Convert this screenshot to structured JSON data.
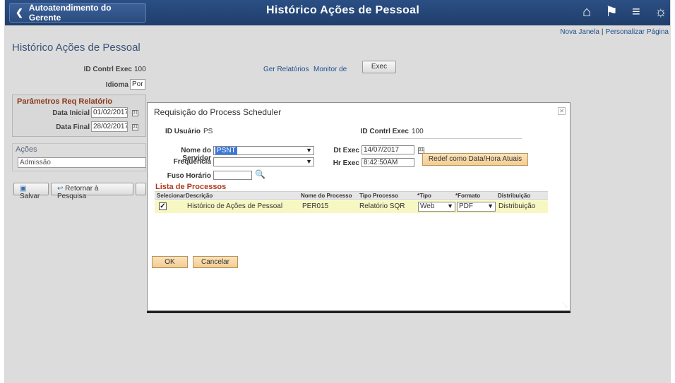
{
  "topbar": {
    "back_label": "Autoatendimento do Gerente",
    "title": "Histórico Ações de Pessoal",
    "icons": [
      "home-icon",
      "flag-icon",
      "menu-icon",
      "compass-icon"
    ]
  },
  "links": {
    "nova_janela": "Nova Janela",
    "sep": "|",
    "personalizar": "Personalizar Página"
  },
  "page": {
    "title": "Histórico Ações de Pessoal",
    "id_contrl_label": "ID Contrl Exec",
    "id_contrl_value": "100",
    "ger_relatorios": "Ger Relatórios",
    "monitor": "Monitor de",
    "exec_button": "Exec",
    "idioma_label": "Idioma",
    "idioma_value": "Por"
  },
  "params": {
    "title": "Parâmetros Req Relatório",
    "data_inicial_label": "Data Inicial",
    "data_inicial_value": "01/02/2017",
    "data_final_label": "Data Final",
    "data_final_value": "28/02/2017"
  },
  "acoes": {
    "title": "Ações",
    "value": "Admissão"
  },
  "buttons": {
    "salvar": "Salvar",
    "retornar": "Retornar à Pesquisa"
  },
  "modal": {
    "title": "Requisição do Process Scheduler",
    "id_usuario_label": "ID Usuário",
    "id_usuario_value": "PS",
    "id_contrl_label": "ID Contrl Exec",
    "id_contrl_value": "100",
    "servidor_label": "Nome do Servidor",
    "servidor_value": "PSNT",
    "frequencia_label": "Frequência",
    "frequencia_value": "",
    "fuso_label": "Fuso Horário",
    "fuso_value": "",
    "dt_exec_label": "Dt Exec",
    "dt_exec_value": "14/07/2017",
    "hr_exec_label": "Hr Exec",
    "hr_exec_value": "8:42:50AM",
    "redef_button": "Redef como Data/Hora Atuais",
    "list_title": "Lista de Processos",
    "columns": [
      "Selecionar",
      "Descrição",
      "Nome do Processo",
      "Tipo Processo",
      "*Tipo",
      "*Formato",
      "Distribuição"
    ],
    "row": {
      "selected": true,
      "descricao": "Histórico de Ações de Pessoal",
      "nome_processo": "PER015",
      "tipo_processo": "Relatório SQR",
      "tipo": "Web",
      "formato": "PDF",
      "distribuicao": "Distribuição"
    },
    "ok_button": "OK",
    "cancel_button": "Cancelar"
  }
}
